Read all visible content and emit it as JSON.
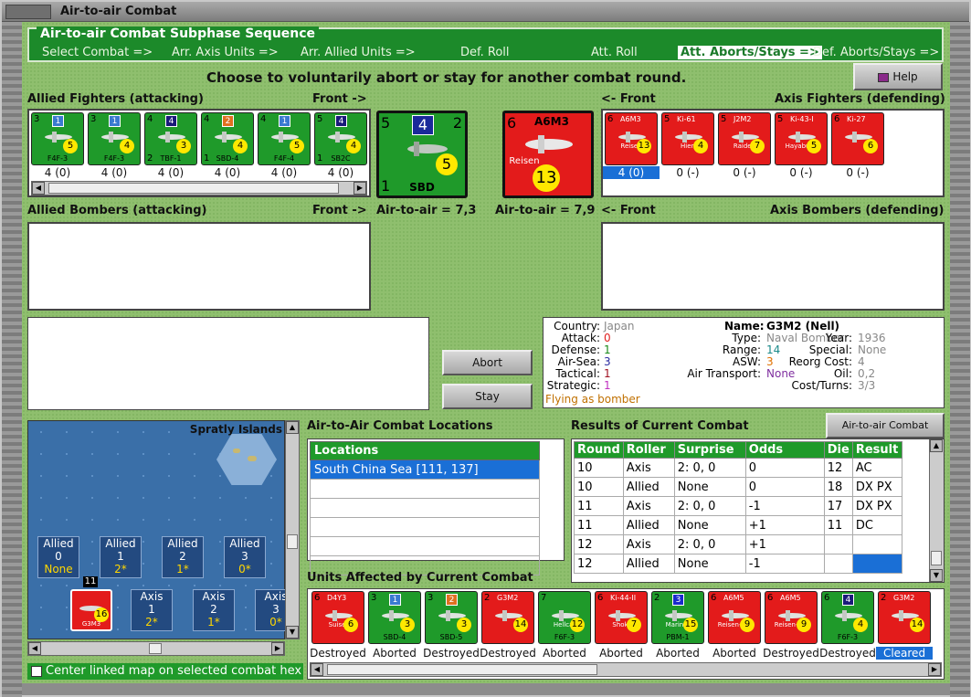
{
  "window_title": "Air-to-air Combat",
  "sequence": {
    "title": "Air-to-air Combat Subphase Sequence",
    "steps": [
      "Select Combat =>",
      "Arr. Axis Units =>",
      "Arr. Allied Units =>",
      "Def. Roll",
      "Att. Roll",
      "Att. Aborts/Stays =>",
      "Def. Aborts/Stays =>"
    ]
  },
  "instruction": "Choose to voluntarily abort or stay for another combat round.",
  "help_label": "Help",
  "labels": {
    "allied_fighters": "Allied Fighters (attacking)",
    "front_right": "Front ->",
    "front_left": "<- Front",
    "axis_fighters": "Axis Fighters (defending)",
    "allied_bombers": "Allied Bombers (attacking)",
    "axis_bombers": "Axis Bombers (defending)",
    "air_allied": "Air-to-air = 7,3",
    "air_axis": "Air-to-air = 7,9"
  },
  "allied_fighters": [
    {
      "tl": "3",
      "box": "1",
      "name": "F4F-3",
      "val": "5",
      "count": "4 (0)"
    },
    {
      "tl": "3",
      "box": "1",
      "name": "F4F-3",
      "val": "4",
      "count": "4 (0)"
    },
    {
      "tl": "4",
      "box": "4",
      "name": "TBF-1",
      "val": "3",
      "bl": "2",
      "count": "4 (0)"
    },
    {
      "tl": "4",
      "box": "2",
      "name": "SBD-4",
      "val": "4",
      "bl": "1",
      "count": "4 (0)"
    },
    {
      "tl": "4",
      "box": "1",
      "name": "F4F-4",
      "val": "5",
      "count": "4 (0)"
    },
    {
      "tl": "5",
      "box": "4",
      "name": "SB2C",
      "val": "4",
      "bl": "1",
      "count": "4 (0)"
    }
  ],
  "big_allied": {
    "tl": "5",
    "box": "4",
    "tr": "2",
    "bl": "1",
    "name": "SBD",
    "val": "5"
  },
  "big_axis": {
    "tl": "6",
    "name": "A6M3",
    "sub": "Reisen",
    "val": "13"
  },
  "axis_fighters": [
    {
      "tl": "6",
      "name": "A6M3",
      "sub": "Reisen",
      "val": "13",
      "count": "4 (0)"
    },
    {
      "tl": "5",
      "name": "Ki-61",
      "sub": "Hien",
      "val": "4",
      "count": "0 (-)"
    },
    {
      "tl": "5",
      "name": "J2M2",
      "sub": "Raiden",
      "val": "7",
      "count": "0 (-)"
    },
    {
      "tl": "5",
      "name": "Ki-43-I",
      "sub": "Hayabusa",
      "val": "5",
      "count": "0 (-)"
    },
    {
      "tl": "6",
      "name": "Ki-27",
      "sub": "",
      "val": "6",
      "count": "0 (-)"
    }
  ],
  "buttons": {
    "abort": "Abort",
    "stay": "Stay",
    "chart": "Air-to-air Combat Chart"
  },
  "info": {
    "country_k": "Country:",
    "country": "Japan",
    "attack_k": "Attack:",
    "attack": "0",
    "defense_k": "Defense:",
    "defense": "1",
    "airsea_k": "Air-Sea:",
    "airsea": "3",
    "tactical_k": "Tactical:",
    "tactical": "1",
    "strategic_k": "Strategic:",
    "strategic": "1",
    "flying": "Flying as bomber",
    "name_k": "Name:",
    "name": "G3M2 (Nell)",
    "type_k": "Type:",
    "type": "Naval Bomber",
    "year_k": "Year:",
    "year": "1936",
    "range_k": "Range:",
    "range": "14",
    "special_k": "Special:",
    "special": "None",
    "asw_k": "ASW:",
    "asw": "3",
    "reorg_k": "Reorg Cost:",
    "reorg": "4",
    "transport_k": "Air Transport:",
    "transport": "None",
    "oil_k": "Oil:",
    "oil": "0,2",
    "cost_k": "Cost/Turns:",
    "cost": "3/3"
  },
  "locations": {
    "title": "Air-to-Air Combat Locations",
    "header": "Locations",
    "rows": [
      "South China Sea [111, 137]",
      "",
      "",
      "",
      "",
      ""
    ]
  },
  "results": {
    "title": "Results of Current Combat",
    "headers": [
      "Round",
      "Roller",
      "Surprise",
      "Odds",
      "Die",
      "Result"
    ],
    "rows": [
      [
        "10",
        "Axis",
        "2: 0, 0",
        "0",
        "12",
        "AC"
      ],
      [
        "10",
        "Allied",
        "None",
        "0",
        "18",
        "DX PX"
      ],
      [
        "11",
        "Axis",
        "2: 0, 0",
        "-1",
        "17",
        "DX PX"
      ],
      [
        "11",
        "Allied",
        "None",
        "+1",
        "11",
        "DC"
      ],
      [
        "12",
        "Axis",
        "2: 0, 0",
        "+1",
        "",
        ""
      ],
      [
        "12",
        "Allied",
        "None",
        "-1",
        "",
        ""
      ]
    ]
  },
  "map": {
    "title": "Spratly Islands",
    "allied": [
      {
        "label": "Allied",
        "n": "0",
        "v": "None"
      },
      {
        "label": "Allied",
        "n": "1",
        "v": "2*"
      },
      {
        "label": "Allied",
        "n": "2",
        "v": "1*"
      },
      {
        "label": "Allied",
        "n": "3",
        "v": "0*"
      }
    ],
    "axis": [
      {
        "label": "Axis",
        "n": "1",
        "v": "2*"
      },
      {
        "label": "Axis",
        "n": "2",
        "v": "1*"
      },
      {
        "label": "Axis",
        "n": "3",
        "v": "0*"
      }
    ],
    "stack_num": "11",
    "unit_name": "G3M3",
    "unit_val": "16"
  },
  "center_check": "Center linked map on selected combat hex",
  "affected": {
    "title": "Units Affected by Current Combat",
    "units": [
      {
        "c": "r",
        "tl": "6",
        "name": "D4Y3",
        "sub": "Suisei",
        "val": "6",
        "cap": "Destroyed"
      },
      {
        "c": "g",
        "tl": "3",
        "box": "1",
        "name": "SBD-4",
        "val": "3",
        "cap": "Aborted"
      },
      {
        "c": "g",
        "tl": "3",
        "box": "2",
        "name": "SBD-5",
        "val": "3",
        "cap": "Destroyed"
      },
      {
        "c": "r",
        "tl": "2",
        "name": "G3M2",
        "val": "14",
        "cap": "Destroyed"
      },
      {
        "c": "g",
        "tl": "7",
        "name": "F6F-3",
        "sub": "Hellcat",
        "val": "12",
        "cap": "Aborted"
      },
      {
        "c": "r",
        "tl": "6",
        "name": "Ki-44-II",
        "sub": "Shoki",
        "val": "7",
        "cap": "Aborted"
      },
      {
        "c": "g",
        "tl": "2",
        "box": "3",
        "name": "PBM-1",
        "sub": "Mariner",
        "val": "15",
        "cap": "Aborted"
      },
      {
        "c": "r",
        "tl": "6",
        "name": "A6M5",
        "sub": "Reisen-Kai",
        "val": "9",
        "cap": "Aborted"
      },
      {
        "c": "r",
        "tl": "6",
        "name": "A6M5",
        "sub": "Reisen-Kai",
        "val": "9",
        "cap": "Destroyed"
      },
      {
        "c": "g",
        "tl": "6",
        "box": "4",
        "name": "F6F-3",
        "val": "4",
        "cap": "Destroyed"
      },
      {
        "c": "r",
        "tl": "2",
        "name": "G3M2",
        "val": "14",
        "cap": "Cleared",
        "sel": true
      }
    ]
  }
}
